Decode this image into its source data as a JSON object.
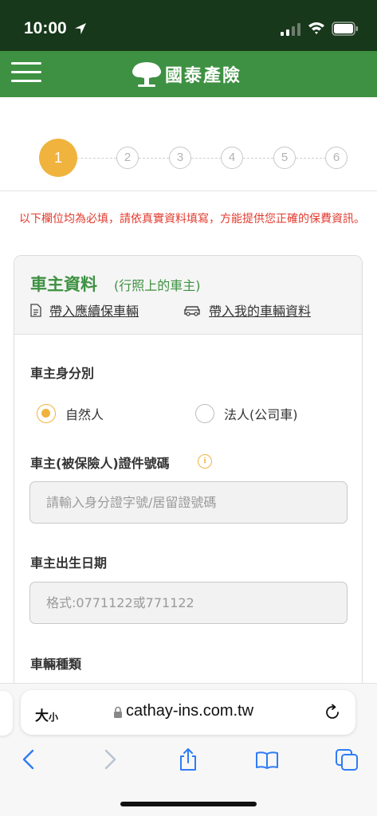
{
  "status_bar": {
    "time": "10:00"
  },
  "header": {
    "brand_name": "國泰產險",
    "icons": [
      "menu-icon",
      "cathay-tree-logo"
    ]
  },
  "steps": [
    "1",
    "2",
    "3",
    "4",
    "5",
    "6"
  ],
  "active_step": 1,
  "notice": "以下欄位均為必填，請依真實資料填寫，方能提供您正確的保費資訊。",
  "card": {
    "title": "車主資料",
    "subtitle": "(行照上的車主)",
    "link_renewal": "帶入應續保車輛",
    "link_my_vehicle": "帶入我的車輛資料"
  },
  "form": {
    "identity_label": "車主身分別",
    "radio_natural": "自然人",
    "radio_corporate": "法人(公司車)",
    "selected_identity": "自然人",
    "id_label": "車主(被保險人)證件號碼",
    "info_icon": "i",
    "id_placeholder": "請輸入身分證字號/居留證號碼",
    "birth_label": "車主出生日期",
    "birth_placeholder": "格式:0771122或771122",
    "vehicle_type_label": "車輛種類"
  },
  "browser": {
    "text_size_big": "大",
    "text_size_small": "小",
    "url": "cathay-ins.com.tw",
    "icons": [
      "lock-icon",
      "reload-icon",
      "back-icon",
      "forward-icon",
      "share-icon",
      "bookmarks-icon",
      "tabs-icon"
    ]
  },
  "colors": {
    "brand_green": "#3e9142",
    "status_bar": "#17381a",
    "accent_orange": "#f0b33d",
    "notice_red": "#e33a2e"
  }
}
